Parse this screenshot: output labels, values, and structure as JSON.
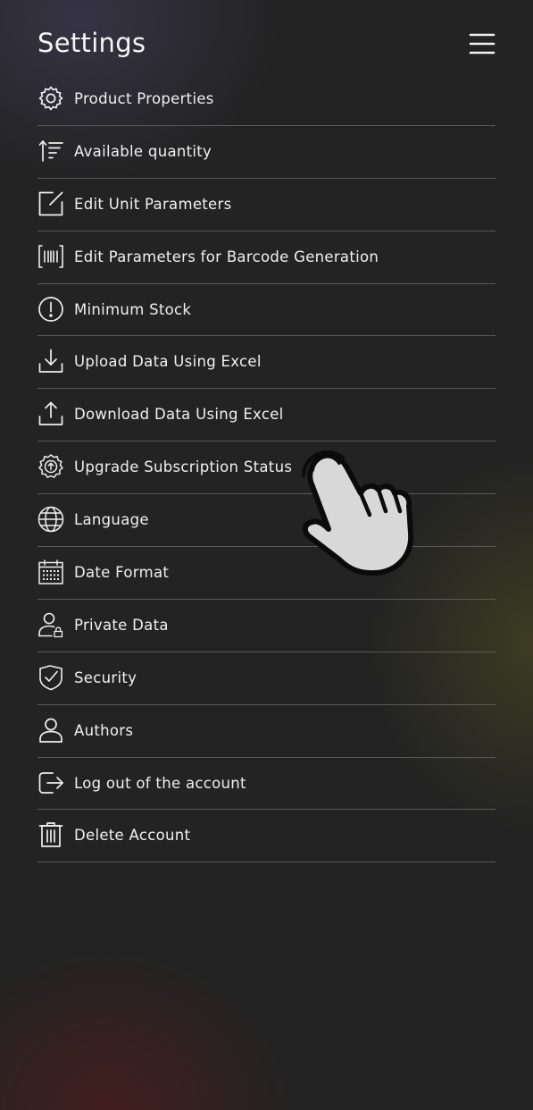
{
  "header": {
    "title": "Settings",
    "menu_icon": "hamburger-menu-icon"
  },
  "settings": {
    "items": [
      {
        "label": "Product Properties",
        "icon": "gear-icon"
      },
      {
        "label": "Available quantity",
        "icon": "sort-quantity-icon"
      },
      {
        "label": "Edit Unit Parameters",
        "icon": "edit-square-icon"
      },
      {
        "label": "Edit Parameters for Barcode Generation",
        "icon": "barcode-icon"
      },
      {
        "label": "Minimum Stock",
        "icon": "exclamation-circle-icon"
      },
      {
        "label": "Upload Data Using Excel",
        "icon": "download-arrow-icon"
      },
      {
        "label": "Download Data Using Excel",
        "icon": "upload-arrow-icon"
      },
      {
        "label": "Upgrade Subscription Status",
        "icon": "upgrade-gear-icon"
      },
      {
        "label": "Language",
        "icon": "globe-icon"
      },
      {
        "label": "Date Format",
        "icon": "calendar-icon"
      },
      {
        "label": "Private Data",
        "icon": "user-lock-icon"
      },
      {
        "label": "Security",
        "icon": "shield-check-icon"
      },
      {
        "label": "Authors",
        "icon": "user-icon"
      },
      {
        "label": "Log out of the account",
        "icon": "logout-icon"
      },
      {
        "label": "Delete Account",
        "icon": "trash-icon"
      }
    ]
  },
  "overlay": {
    "pointer_icon": "pointing-hand-icon"
  },
  "colors": {
    "background": "#232323",
    "text": "#f0f0f0",
    "divider": "#5a5a5a"
  }
}
